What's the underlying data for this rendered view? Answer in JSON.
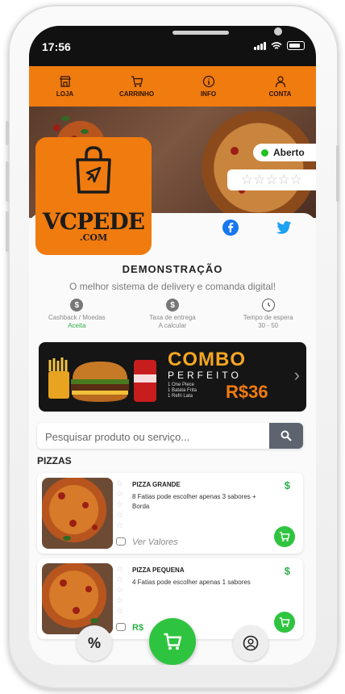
{
  "status_bar": {
    "time": "17:56"
  },
  "nav": [
    {
      "label": "LOJA",
      "icon": "store-icon"
    },
    {
      "label": "CARRINHO",
      "icon": "cart-icon"
    },
    {
      "label": "INFO",
      "icon": "info-icon"
    },
    {
      "label": "CONTA",
      "icon": "user-icon"
    }
  ],
  "hero": {
    "status_label": "Aberto",
    "rating": "☆☆☆☆☆"
  },
  "logo": {
    "brand_top": "VCPEDE",
    "brand_bottom": ".COM"
  },
  "store": {
    "name": "DEMONSTRAÇÃO",
    "description": "O melhor sistema de delivery e comanda digital!"
  },
  "info": [
    {
      "title": "Cashback / Moedas",
      "value": "Aceita",
      "icon": "dollar-icon"
    },
    {
      "title": "Taxa de entrega",
      "value": "A calcular",
      "icon": "dollar-icon"
    },
    {
      "title": "Tempo de espera",
      "value": "30 - 50",
      "icon": "clock-icon"
    }
  ],
  "banner": {
    "line1": "COMBO",
    "line2": "PERFEITO",
    "items": [
      "1 One Piece",
      "1 Batata Frita",
      "1 Refri Lata"
    ],
    "price": "R$36"
  },
  "search": {
    "placeholder": "Pesquisar produto ou serviço..."
  },
  "section": {
    "title": "PIZZAS"
  },
  "products": [
    {
      "title": "PIZZA GRANDE",
      "description": "8 Fatias pode escolher apenas 3 sabores + Borda",
      "price_symbol": "$",
      "link": "Ver Valores"
    },
    {
      "title": "PIZZA PEQUENA",
      "description": "4 Fatias pode escolher apenas 1 sabores",
      "price_symbol": "$",
      "link": "R$ "
    }
  ],
  "bottom_bar": {
    "discount_label": "%"
  },
  "colors": {
    "brand": "#f07b0f",
    "accent_green": "#2fc43f",
    "search_button": "#5d6470"
  }
}
